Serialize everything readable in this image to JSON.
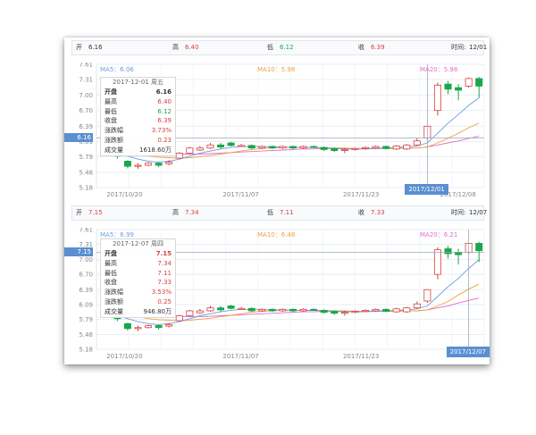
{
  "colors": {
    "up": "#d94040",
    "down": "#1aa64a",
    "ma5": "#6c9fe0",
    "ma10": "#f0a040",
    "ma20": "#e06ed0",
    "grid": "#e8eef4",
    "axis": "#888888",
    "flag": "#5a8fd0"
  },
  "panels": [
    {
      "info": {
        "open_label": "开",
        "open": "6.16",
        "high_label": "高",
        "high": "6.40",
        "low_label": "低",
        "low": "6.12",
        "close_label": "收",
        "close": "6.39",
        "time_label": "时间:",
        "time": "12/01"
      },
      "ma": {
        "ma5": "MA5：6.06",
        "ma10": "MA10：5.98",
        "ma20": "MA20：5.98"
      },
      "y_ticks": [
        "7.61",
        "7.31",
        "7.00",
        "6.70",
        "6.39",
        "6.09",
        "5.79",
        "5.48",
        "5.18"
      ],
      "price_flag": "6.16",
      "x_ticks": [
        "2017/10/20",
        "2017/11/07",
        "2017/11/23",
        "2017/12/08"
      ],
      "date_flag": "2017/12/01",
      "tooltip": {
        "date": "2017-12-01 周五",
        "rows": [
          {
            "label": "开盘",
            "value": "6.16"
          },
          {
            "label": "最高",
            "value": "6.40"
          },
          {
            "label": "最低",
            "value": "6.12"
          },
          {
            "label": "收盘",
            "value": "6.39"
          },
          {
            "label": "涨跌幅",
            "value": "3.73%"
          },
          {
            "label": "涨跌额",
            "value": "0.23"
          },
          {
            "label": "成交量",
            "value": "1618.60万"
          }
        ]
      }
    },
    {
      "info": {
        "open_label": "开",
        "open": "7.15",
        "high_label": "高",
        "high": "7.34",
        "low_label": "低",
        "low": "7.11",
        "close_label": "收",
        "close": "7.33",
        "time_label": "时间:",
        "time": "12/07"
      },
      "ma": {
        "ma5": "MA5：6.99",
        "ma10": "MA10：6.48",
        "ma20": "MA20：6.21"
      },
      "y_ticks": [
        "7.61",
        "7.31",
        "7.00",
        "6.70",
        "6.39",
        "6.09",
        "5.79",
        "5.48",
        "5.18"
      ],
      "price_flag": "7.15",
      "x_ticks": [
        "2017/10/20",
        "2017/11/07",
        "2017/11/23"
      ],
      "date_flag": "2017/12/07",
      "tooltip": {
        "date": "2017-12-07 周四",
        "rows": [
          {
            "label": "开盘",
            "value": "7.15"
          },
          {
            "label": "最高",
            "value": "7.34"
          },
          {
            "label": "最低",
            "value": "7.11"
          },
          {
            "label": "收盘",
            "value": "7.33"
          },
          {
            "label": "涨跌幅",
            "value": "3.53%"
          },
          {
            "label": "涨跌额",
            "value": "0.25"
          },
          {
            "label": "成交量",
            "value": "946.80万"
          }
        ]
      }
    }
  ],
  "chart_data": [
    {
      "type": "candlestick",
      "y_range": [
        5.18,
        7.61
      ],
      "candles": [
        {
          "o": 5.95,
          "c": 5.9,
          "h": 5.97,
          "l": 5.86
        },
        {
          "o": 5.85,
          "c": 5.8,
          "h": 5.88,
          "l": 5.75
        },
        {
          "o": 5.7,
          "c": 5.6,
          "h": 5.72,
          "l": 5.56
        },
        {
          "o": 5.62,
          "c": 5.62,
          "h": 5.66,
          "l": 5.55
        },
        {
          "o": 5.62,
          "c": 5.66,
          "h": 5.68,
          "l": 5.6
        },
        {
          "o": 5.66,
          "c": 5.62,
          "h": 5.68,
          "l": 5.58
        },
        {
          "o": 5.65,
          "c": 5.68,
          "h": 5.72,
          "l": 5.62
        },
        {
          "o": 5.76,
          "c": 5.86,
          "h": 5.88,
          "l": 5.74
        },
        {
          "o": 5.86,
          "c": 5.96,
          "h": 5.98,
          "l": 5.84
        },
        {
          "o": 5.92,
          "c": 5.96,
          "h": 6.0,
          "l": 5.9
        },
        {
          "o": 5.96,
          "c": 6.02,
          "h": 6.06,
          "l": 5.94
        },
        {
          "o": 6.02,
          "c": 5.98,
          "h": 6.06,
          "l": 5.94
        },
        {
          "o": 6.06,
          "c": 6.01,
          "h": 6.08,
          "l": 5.99
        },
        {
          "o": 6.01,
          "c": 6.01,
          "h": 6.04,
          "l": 5.98
        },
        {
          "o": 6.01,
          "c": 5.96,
          "h": 6.03,
          "l": 5.94
        },
        {
          "o": 5.96,
          "c": 5.99,
          "h": 6.01,
          "l": 5.94
        },
        {
          "o": 5.99,
          "c": 5.96,
          "h": 6.01,
          "l": 5.94
        },
        {
          "o": 5.96,
          "c": 5.99,
          "h": 6.01,
          "l": 5.94
        },
        {
          "o": 5.99,
          "c": 5.96,
          "h": 6.01,
          "l": 5.93
        },
        {
          "o": 5.96,
          "c": 5.99,
          "h": 6.01,
          "l": 5.94
        },
        {
          "o": 5.99,
          "c": 5.98,
          "h": 6.01,
          "l": 5.96
        },
        {
          "o": 5.97,
          "c": 5.93,
          "h": 5.99,
          "l": 5.9
        },
        {
          "o": 5.95,
          "c": 5.91,
          "h": 5.97,
          "l": 5.88
        },
        {
          "o": 5.91,
          "c": 5.93,
          "h": 5.96,
          "l": 5.86
        },
        {
          "o": 5.93,
          "c": 5.95,
          "h": 5.97,
          "l": 5.91
        },
        {
          "o": 5.95,
          "c": 5.97,
          "h": 5.99,
          "l": 5.93
        },
        {
          "o": 5.96,
          "c": 5.99,
          "h": 6.01,
          "l": 5.94
        },
        {
          "o": 5.99,
          "c": 5.95,
          "h": 6.01,
          "l": 5.93
        },
        {
          "o": 5.94,
          "c": 6.0,
          "h": 6.02,
          "l": 5.92
        },
        {
          "o": 5.94,
          "c": 6.02,
          "h": 6.04,
          "l": 5.92
        },
        {
          "o": 6.02,
          "c": 6.1,
          "h": 6.15,
          "l": 6.0
        },
        {
          "o": 6.16,
          "c": 6.39,
          "h": 6.4,
          "l": 6.12
        },
        {
          "o": 6.7,
          "c": 7.2,
          "h": 7.25,
          "l": 6.6
        },
        {
          "o": 7.22,
          "c": 7.12,
          "h": 7.28,
          "l": 7.02
        },
        {
          "o": 7.15,
          "c": 7.1,
          "h": 7.22,
          "l": 6.9
        },
        {
          "o": 7.18,
          "c": 7.33,
          "h": 7.35,
          "l": 7.15
        },
        {
          "o": 7.33,
          "c": 7.18,
          "h": 7.36,
          "l": 6.95
        }
      ],
      "ma5": [
        5.9,
        5.86,
        5.8,
        5.74,
        5.7,
        5.68,
        5.7,
        5.74,
        5.8,
        5.86,
        5.9,
        5.94,
        5.97,
        5.99,
        5.99,
        5.99,
        5.98,
        5.98,
        5.97,
        5.97,
        5.97,
        5.96,
        5.95,
        5.94,
        5.94,
        5.94,
        5.95,
        5.96,
        5.97,
        5.98,
        6.0,
        6.06,
        6.25,
        6.45,
        6.62,
        6.8,
        6.95
      ],
      "ma10": [
        5.93,
        5.91,
        5.88,
        5.84,
        5.8,
        5.78,
        5.77,
        5.76,
        5.77,
        5.79,
        5.81,
        5.84,
        5.87,
        5.9,
        5.93,
        5.95,
        5.96,
        5.97,
        5.97,
        5.97,
        5.97,
        5.97,
        5.96,
        5.96,
        5.95,
        5.95,
        5.95,
        5.95,
        5.95,
        5.96,
        5.96,
        5.98,
        6.06,
        6.15,
        6.25,
        6.36,
        6.45
      ],
      "ma20": [
        5.96,
        5.94,
        5.92,
        5.9,
        5.88,
        5.86,
        5.85,
        5.84,
        5.84,
        5.84,
        5.85,
        5.86,
        5.87,
        5.88,
        5.89,
        5.9,
        5.91,
        5.92,
        5.93,
        5.94,
        5.94,
        5.95,
        5.95,
        5.95,
        5.95,
        5.95,
        5.96,
        5.96,
        5.96,
        5.96,
        5.96,
        5.98,
        6.02,
        6.06,
        6.1,
        6.15,
        6.19
      ],
      "highlight_index": 31
    },
    {
      "type": "candlestick",
      "y_range": [
        5.18,
        7.61
      ],
      "candles": [
        {
          "o": 5.95,
          "c": 5.9,
          "h": 5.97,
          "l": 5.86
        },
        {
          "o": 5.85,
          "c": 5.8,
          "h": 5.88,
          "l": 5.75
        },
        {
          "o": 5.7,
          "c": 5.6,
          "h": 5.72,
          "l": 5.56
        },
        {
          "o": 5.62,
          "c": 5.62,
          "h": 5.66,
          "l": 5.55
        },
        {
          "o": 5.62,
          "c": 5.66,
          "h": 5.68,
          "l": 5.6
        },
        {
          "o": 5.66,
          "c": 5.62,
          "h": 5.68,
          "l": 5.58
        },
        {
          "o": 5.65,
          "c": 5.68,
          "h": 5.72,
          "l": 5.62
        },
        {
          "o": 5.76,
          "c": 5.86,
          "h": 5.88,
          "l": 5.74
        },
        {
          "o": 5.86,
          "c": 5.96,
          "h": 5.98,
          "l": 5.84
        },
        {
          "o": 5.92,
          "c": 5.96,
          "h": 6.0,
          "l": 5.9
        },
        {
          "o": 5.96,
          "c": 6.02,
          "h": 6.06,
          "l": 5.94
        },
        {
          "o": 6.02,
          "c": 5.98,
          "h": 6.06,
          "l": 5.94
        },
        {
          "o": 6.06,
          "c": 6.01,
          "h": 6.08,
          "l": 5.99
        },
        {
          "o": 6.01,
          "c": 6.01,
          "h": 6.04,
          "l": 5.98
        },
        {
          "o": 6.01,
          "c": 5.96,
          "h": 6.03,
          "l": 5.94
        },
        {
          "o": 5.96,
          "c": 5.99,
          "h": 6.01,
          "l": 5.94
        },
        {
          "o": 5.99,
          "c": 5.96,
          "h": 6.01,
          "l": 5.94
        },
        {
          "o": 5.96,
          "c": 5.99,
          "h": 6.01,
          "l": 5.94
        },
        {
          "o": 5.99,
          "c": 5.96,
          "h": 6.01,
          "l": 5.93
        },
        {
          "o": 5.96,
          "c": 5.99,
          "h": 6.01,
          "l": 5.94
        },
        {
          "o": 5.99,
          "c": 5.98,
          "h": 6.01,
          "l": 5.96
        },
        {
          "o": 5.97,
          "c": 5.93,
          "h": 5.99,
          "l": 5.9
        },
        {
          "o": 5.95,
          "c": 5.91,
          "h": 5.97,
          "l": 5.88
        },
        {
          "o": 5.91,
          "c": 5.93,
          "h": 5.96,
          "l": 5.86
        },
        {
          "o": 5.93,
          "c": 5.95,
          "h": 5.97,
          "l": 5.91
        },
        {
          "o": 5.95,
          "c": 5.97,
          "h": 5.99,
          "l": 5.93
        },
        {
          "o": 5.96,
          "c": 5.99,
          "h": 6.01,
          "l": 5.94
        },
        {
          "o": 5.99,
          "c": 5.95,
          "h": 6.01,
          "l": 5.93
        },
        {
          "o": 5.94,
          "c": 6.0,
          "h": 6.02,
          "l": 5.92
        },
        {
          "o": 5.94,
          "c": 6.02,
          "h": 6.04,
          "l": 5.92
        },
        {
          "o": 6.02,
          "c": 6.1,
          "h": 6.15,
          "l": 6.0
        },
        {
          "o": 6.16,
          "c": 6.39,
          "h": 6.4,
          "l": 6.12
        },
        {
          "o": 6.7,
          "c": 7.2,
          "h": 7.25,
          "l": 6.6
        },
        {
          "o": 7.22,
          "c": 7.12,
          "h": 7.28,
          "l": 7.02
        },
        {
          "o": 7.15,
          "c": 7.1,
          "h": 7.22,
          "l": 6.9
        },
        {
          "o": 7.15,
          "c": 7.33,
          "h": 7.34,
          "l": 7.11
        },
        {
          "o": 7.33,
          "c": 7.18,
          "h": 7.36,
          "l": 6.95
        }
      ],
      "ma5": [
        5.9,
        5.86,
        5.8,
        5.74,
        5.7,
        5.68,
        5.7,
        5.74,
        5.8,
        5.86,
        5.9,
        5.94,
        5.97,
        5.99,
        5.99,
        5.99,
        5.98,
        5.98,
        5.97,
        5.97,
        5.97,
        5.96,
        5.95,
        5.94,
        5.94,
        5.94,
        5.95,
        5.96,
        5.97,
        5.98,
        6.0,
        6.06,
        6.25,
        6.45,
        6.62,
        6.82,
        7.0
      ],
      "ma10": [
        5.93,
        5.91,
        5.88,
        5.84,
        5.8,
        5.78,
        5.77,
        5.76,
        5.77,
        5.79,
        5.81,
        5.84,
        5.87,
        5.9,
        5.93,
        5.95,
        5.96,
        5.97,
        5.97,
        5.97,
        5.97,
        5.97,
        5.96,
        5.96,
        5.95,
        5.95,
        5.95,
        5.95,
        5.95,
        5.96,
        5.96,
        5.98,
        6.06,
        6.15,
        6.28,
        6.4,
        6.5
      ],
      "ma20": [
        5.96,
        5.94,
        5.92,
        5.9,
        5.88,
        5.86,
        5.85,
        5.84,
        5.84,
        5.84,
        5.85,
        5.86,
        5.87,
        5.88,
        5.89,
        5.9,
        5.91,
        5.92,
        5.93,
        5.94,
        5.94,
        5.95,
        5.95,
        5.95,
        5.95,
        5.95,
        5.96,
        5.96,
        5.96,
        5.96,
        5.96,
        5.98,
        6.02,
        6.06,
        6.12,
        6.17,
        6.22
      ],
      "highlight_index": 35
    }
  ]
}
